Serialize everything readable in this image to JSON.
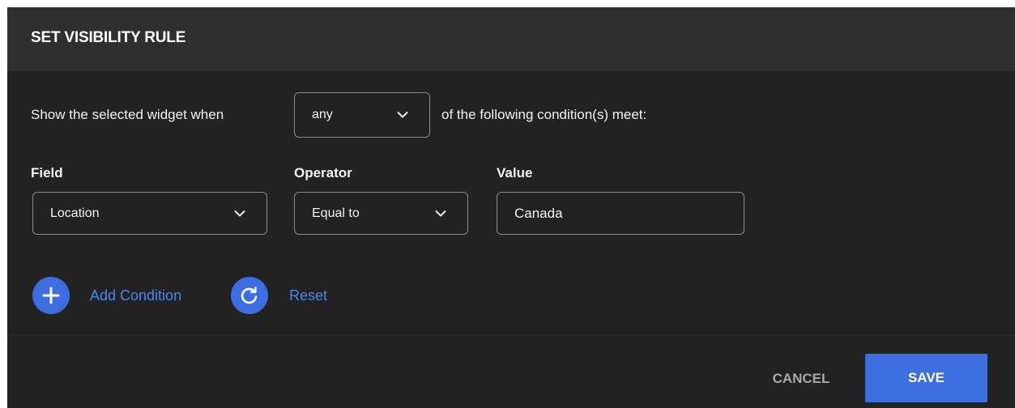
{
  "dialog": {
    "title": "SET VISIBILITY RULE"
  },
  "rule": {
    "prefix": "Show the selected widget when",
    "match_value": "any",
    "suffix": "of the following condition(s) meet:"
  },
  "condition": {
    "field_label": "Field",
    "field_value": "Location",
    "operator_label": "Operator",
    "operator_value": "Equal to",
    "value_label": "Value",
    "value_value": "Canada"
  },
  "actions": {
    "add_condition": "Add Condition",
    "reset": "Reset"
  },
  "footer": {
    "cancel_label": "CANCEL",
    "save_label": "SAVE"
  },
  "colors": {
    "dialog_bg": "#222222",
    "header_bg": "#2f2f2f",
    "accent": "#3d6ee0",
    "link": "#4a86f0",
    "border": "#8a8a8a"
  },
  "icons": {
    "match_dropdown": "chevron-down-icon",
    "field_dropdown": "chevron-down-icon",
    "operator_dropdown": "chevron-down-icon",
    "add": "plus-icon",
    "reset": "reset-icon"
  }
}
